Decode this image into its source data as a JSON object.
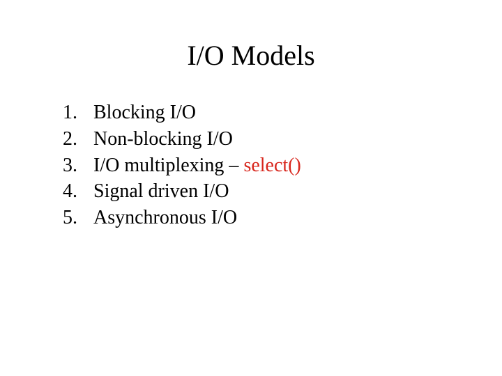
{
  "title": "I/O Models",
  "items": [
    {
      "num": "1.",
      "text": "Blocking I/O",
      "highlight": ""
    },
    {
      "num": "2.",
      "text": "Non-blocking I/O",
      "highlight": ""
    },
    {
      "num": "3.",
      "text": "I/O multiplexing – ",
      "highlight": "select()"
    },
    {
      "num": "4.",
      "text": "Signal driven I/O",
      "highlight": ""
    },
    {
      "num": "5.",
      "text": "Asynchronous I/O",
      "highlight": ""
    }
  ]
}
